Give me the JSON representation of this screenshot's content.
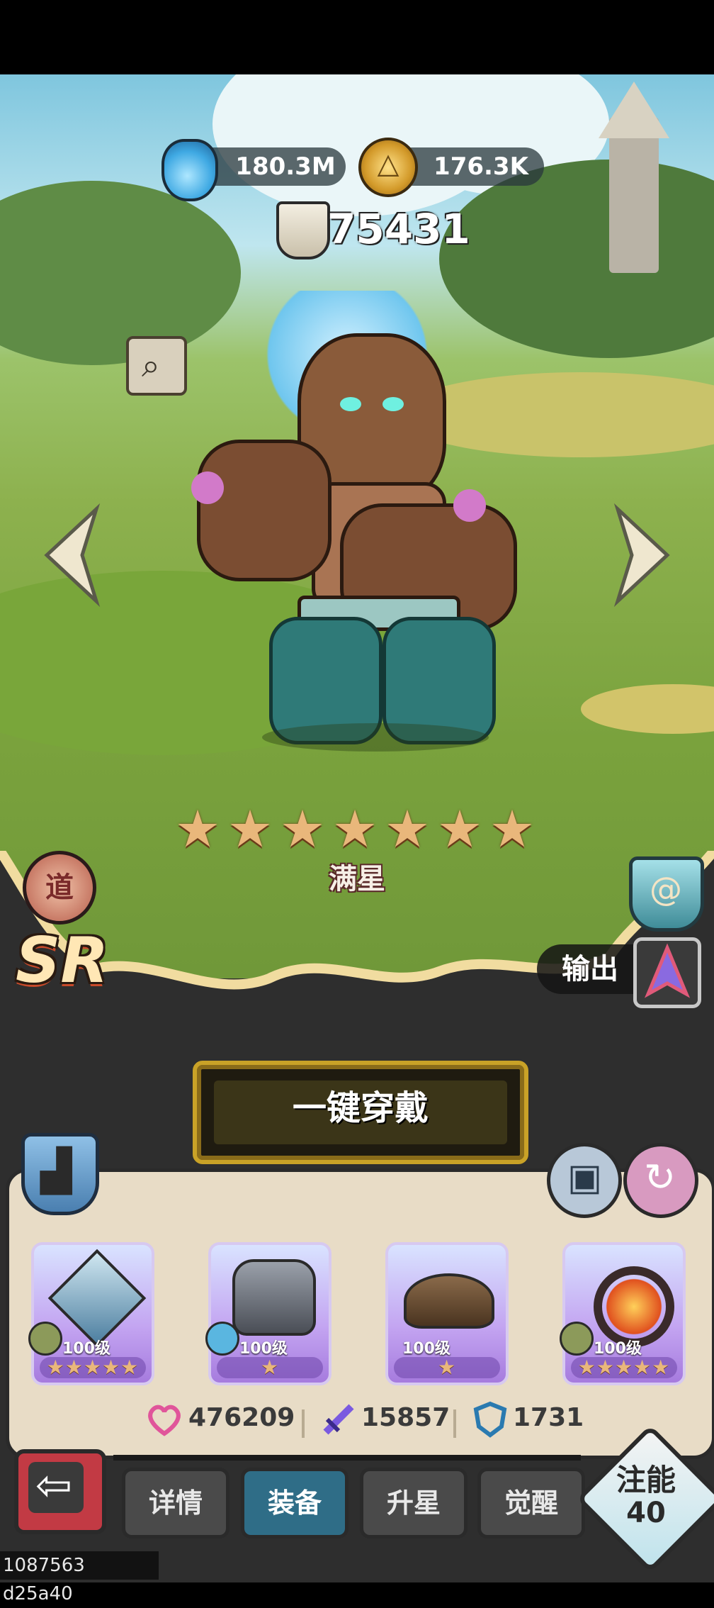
{
  "resources": {
    "potion_value": "180.3M",
    "coin_value": "176.3K",
    "power_value": "75431"
  },
  "hero": {
    "star_count": 7,
    "star_status": "满星",
    "rarity": "SR",
    "faction_badge": "道",
    "role_label": "输出"
  },
  "actions": {
    "equip_all_label": "一键穿戴"
  },
  "equipment": [
    {
      "level": "100级",
      "stars": "★★★★★",
      "icon": "twin-blades-icon",
      "element": "earth"
    },
    {
      "level": "100级",
      "stars": "★",
      "icon": "armor-icon",
      "element": "water"
    },
    {
      "level": "100级",
      "stars": "★",
      "icon": "hat-icon",
      "element": "none"
    },
    {
      "level": "100级",
      "stars": "★★★★★",
      "icon": "flame-ring-icon",
      "element": "earth"
    }
  ],
  "stats": {
    "hp": "476209",
    "attack": "15857",
    "defense": "1731"
  },
  "tabs": [
    {
      "label": "详情"
    },
    {
      "label": "装备"
    },
    {
      "label": "升星"
    },
    {
      "label": "觉醒"
    }
  ],
  "active_tab": 1,
  "inject": {
    "label": "注能",
    "value": "40"
  },
  "debug_text": "1087563 d25a40",
  "colors": {
    "accent": "#2f6d87",
    "panel": "#2e2e2e",
    "parchment": "#e8dcc6",
    "gold": "#c9a227",
    "star": "#e9b77b"
  }
}
